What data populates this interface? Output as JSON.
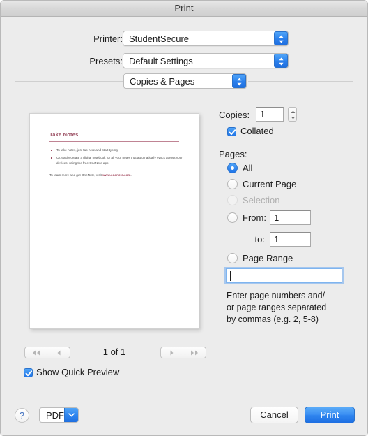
{
  "window": {
    "title": "Print"
  },
  "settings": {
    "printer_label": "Printer:",
    "printer_value": "StudentSecure",
    "presets_label": "Presets:",
    "presets_value": "Default Settings",
    "pane_value": "Copies & Pages"
  },
  "preview": {
    "doc_title": "Take Notes",
    "bullets": [
      "To take notes, just tap here and start typing.",
      "Or, easily create a digital notebook for all your notes that automatically syncs across your devices, using the free OneNote app."
    ],
    "footer_prefix": "To learn more and get OneNote, visit ",
    "footer_link": "www.onenote.com",
    "footer_suffix": ".",
    "page_count": "1 of 1",
    "show_quick_preview_label": "Show Quick Preview",
    "show_quick_preview_checked": true,
    "nav": {
      "first": "first-page",
      "previous": "previous-page",
      "next": "next-page",
      "last": "last-page"
    }
  },
  "copies": {
    "label": "Copies:",
    "value": "1",
    "collated_label": "Collated",
    "collated_checked": true
  },
  "pages": {
    "label": "Pages:",
    "options": [
      {
        "label": "All",
        "selected": true,
        "disabled": false
      },
      {
        "label": "Current Page",
        "selected": false,
        "disabled": false
      },
      {
        "label": "Selection",
        "selected": false,
        "disabled": true
      },
      {
        "label": "From:",
        "selected": false,
        "disabled": false
      },
      {
        "label": "Page Range",
        "selected": false,
        "disabled": false
      }
    ],
    "from_label": "From:",
    "from_value": "1",
    "to_label": "to:",
    "to_value": "1",
    "range_label": "Page Range",
    "range_value": "",
    "hint_lines": [
      "Enter page numbers and/",
      "or page ranges separated",
      "by commas (e.g. 2, 5-8)"
    ]
  },
  "footer": {
    "help_label": "?",
    "pdf_label": "PDF",
    "cancel_label": "Cancel",
    "print_label": "Print"
  },
  "colors": {
    "accent": "#2f86ef",
    "window_bg": "#ececec",
    "doc_heading": "#9b4f63"
  }
}
